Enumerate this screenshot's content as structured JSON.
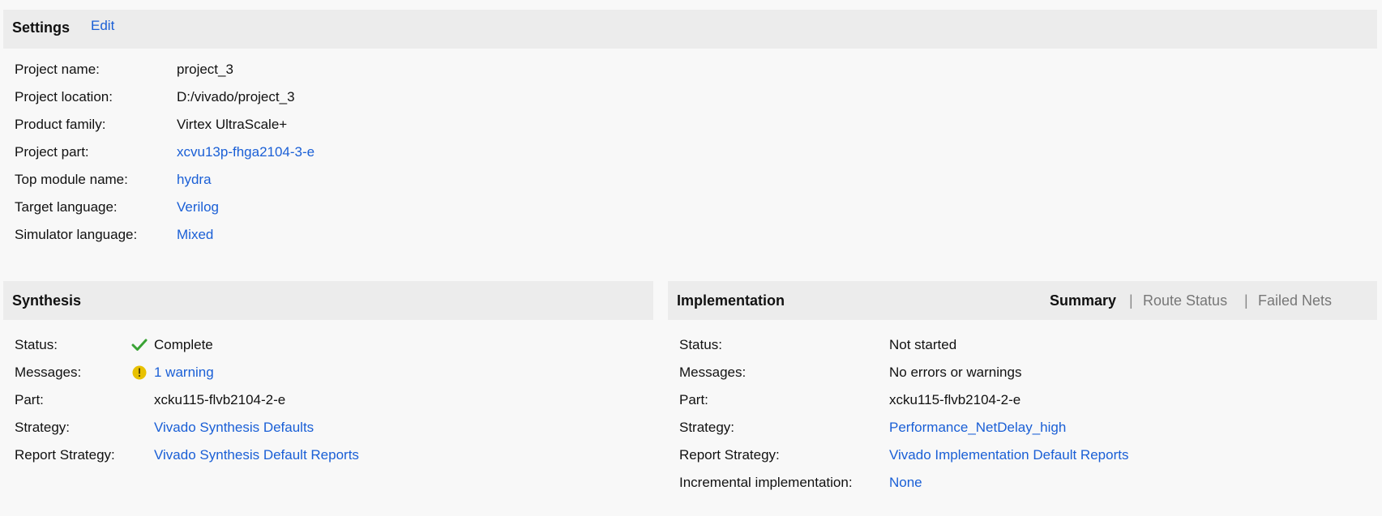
{
  "settings": {
    "title": "Settings",
    "edit_label": "Edit",
    "rows": [
      {
        "label": "Project name:",
        "value": "project_3",
        "link": false
      },
      {
        "label": "Project location:",
        "value": "D:/vivado/project_3",
        "link": false
      },
      {
        "label": "Product family:",
        "value": "Virtex UltraScale+",
        "link": false
      },
      {
        "label": "Project part:",
        "value": "xcvu13p-fhga2104-3-e",
        "link": true
      },
      {
        "label": "Top module name:",
        "value": "hydra",
        "link": true
      },
      {
        "label": "Target language:",
        "value": "Verilog",
        "link": true
      },
      {
        "label": "Simulator language:",
        "value": "Mixed",
        "link": true
      }
    ]
  },
  "synthesis": {
    "title": "Synthesis",
    "rows": [
      {
        "label": "Status:",
        "value": "Complete",
        "link": false,
        "icon": "checkmark-icon"
      },
      {
        "label": "Messages:",
        "value": "1 warning",
        "link": true,
        "icon": "warning-icon"
      },
      {
        "label": "Part:",
        "value": "xcku115-flvb2104-2-e",
        "link": false
      },
      {
        "label": "Strategy:",
        "value": "Vivado Synthesis Defaults",
        "link": true
      },
      {
        "label": "Report Strategy:",
        "value": "Vivado Synthesis Default Reports",
        "link": true
      }
    ]
  },
  "implementation": {
    "title": "Implementation",
    "tabs": {
      "summary": "Summary",
      "route_status": "Route Status",
      "failed_nets": "Failed Nets",
      "separator": "|"
    },
    "rows": [
      {
        "label": "Status:",
        "value": "Not started",
        "link": false
      },
      {
        "label": "Messages:",
        "value": "No errors or warnings",
        "link": false
      },
      {
        "label": "Part:",
        "value": "xcku115-flvb2104-2-e",
        "link": false
      },
      {
        "label": "Strategy:",
        "value": "Performance_NetDelay_high",
        "link": true
      },
      {
        "label": "Report Strategy:",
        "value": "Vivado Implementation Default Reports",
        "link": true
      },
      {
        "label": "Incremental implementation:",
        "value": "None",
        "link": true
      }
    ]
  },
  "colors": {
    "link": "#1a5fd6",
    "header_bg": "#ececec",
    "page_bg": "#f8f8f8",
    "check": "#3aa335",
    "warning": "#e8c100"
  }
}
